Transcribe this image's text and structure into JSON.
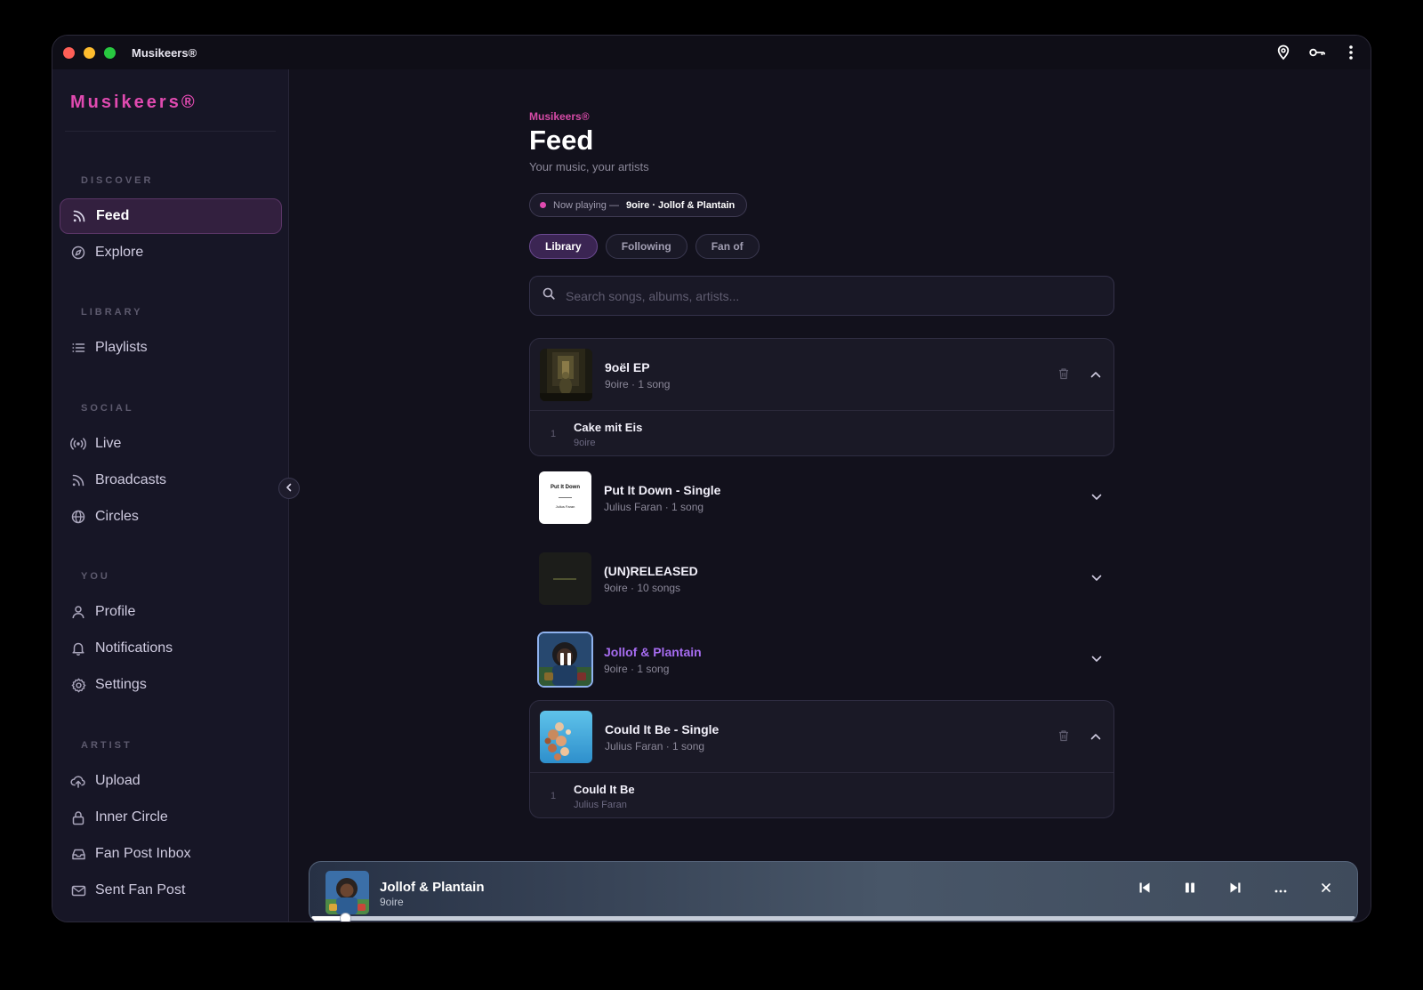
{
  "window": {
    "title": "Musikeers®"
  },
  "sidebar": {
    "brand": "Musikeers®",
    "sections": {
      "discover": "DISCOVER",
      "library": "LIBRARY",
      "social": "SOCIAL",
      "you": "YOU",
      "artist": "ARTIST"
    },
    "items": [
      {
        "label": "Feed",
        "icon": "rss-icon",
        "active": true
      },
      {
        "label": "Explore",
        "icon": "compass-icon"
      },
      {
        "label": "Playlists",
        "icon": "list-icon"
      },
      {
        "label": "Live",
        "icon": "broadcast-icon"
      },
      {
        "label": "Broadcasts",
        "icon": "rss-icon"
      },
      {
        "label": "Circles",
        "icon": "globe-icon"
      },
      {
        "label": "Profile",
        "icon": "user-icon"
      },
      {
        "label": "Notifications",
        "icon": "bell-icon"
      },
      {
        "label": "Settings",
        "icon": "gear-icon"
      },
      {
        "label": "Upload",
        "icon": "cloud-upload-icon"
      },
      {
        "label": "Inner Circle",
        "icon": "lock-icon"
      },
      {
        "label": "Fan Post Inbox",
        "icon": "inbox-icon"
      },
      {
        "label": "Sent Fan Post",
        "icon": "mail-icon"
      }
    ]
  },
  "header": {
    "eyebrow": "Musikeers®",
    "title": "Feed",
    "subtitle": "Your music, your artists"
  },
  "now_playing": {
    "prefix": "Now playing —",
    "track": "9oire · Jollof & Plantain"
  },
  "tabs": [
    {
      "label": "Library",
      "active": true
    },
    {
      "label": "Following"
    },
    {
      "label": "Fan of"
    }
  ],
  "search": {
    "placeholder": "Search songs, albums, artists..."
  },
  "albums": [
    {
      "title": "9oël EP",
      "meta": "9oire · 1 song",
      "expanded": true,
      "tracks": [
        {
          "num": "1",
          "title": "Cake mit Eis",
          "artist": "9oire"
        }
      ]
    },
    {
      "title": "Put It Down - Single",
      "meta": "Julius Faran · 1 song",
      "expanded": false,
      "cover_text": {
        "title": "Put It Down",
        "artist": "Julius Faran"
      }
    },
    {
      "title": "(UN)RELEASED",
      "meta": "9oire · 10 songs",
      "expanded": false
    },
    {
      "title": "Jollof & Plantain",
      "meta": "9oire · 1 song",
      "expanded": false,
      "playing": true
    },
    {
      "title": "Could It Be - Single",
      "meta": "Julius Faran · 1 song",
      "expanded": true,
      "tracks": [
        {
          "num": "1",
          "title": "Could It Be",
          "artist": "Julius Faran"
        }
      ]
    }
  ],
  "player": {
    "title": "Jollof & Plantain",
    "artist": "9oire",
    "progress": 0.032,
    "colors": {
      "accent": "#e04ab0",
      "playing_title": "#a66cf0"
    }
  }
}
